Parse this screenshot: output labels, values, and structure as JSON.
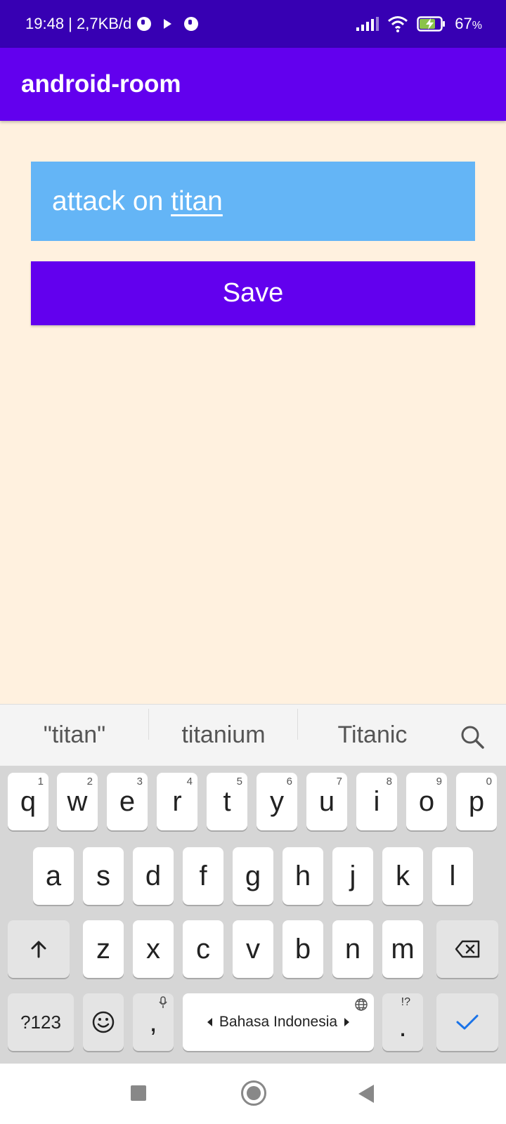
{
  "status_bar": {
    "time_info": "19:48 | 2,7KB/d",
    "battery": "67",
    "battery_unit": "%"
  },
  "app_bar": {
    "title": "android-room"
  },
  "input": {
    "value_prefix": "attack on ",
    "value_composing": "titan"
  },
  "save_button": {
    "label": "Save"
  },
  "suggestions": [
    "\"titan\"",
    "titanium",
    "Titanic"
  ],
  "keyboard": {
    "row1": [
      {
        "key": "q",
        "hint": "1"
      },
      {
        "key": "w",
        "hint": "2"
      },
      {
        "key": "e",
        "hint": "3"
      },
      {
        "key": "r",
        "hint": "4"
      },
      {
        "key": "t",
        "hint": "5"
      },
      {
        "key": "y",
        "hint": "6"
      },
      {
        "key": "u",
        "hint": "7"
      },
      {
        "key": "i",
        "hint": "8"
      },
      {
        "key": "o",
        "hint": "9"
      },
      {
        "key": "p",
        "hint": "0"
      }
    ],
    "row2": [
      "a",
      "s",
      "d",
      "f",
      "g",
      "h",
      "j",
      "k",
      "l"
    ],
    "row3": [
      "z",
      "x",
      "c",
      "v",
      "b",
      "n",
      "m"
    ],
    "symbols_label": "?123",
    "comma": ",",
    "space_label": "Bahasa Indonesia",
    "period": ".",
    "period_hint": "!?",
    "accent_color": "#1a73e8"
  },
  "colors": {
    "status_bar": "#3700b3",
    "app_bar": "#6200ee",
    "background": "#fff1df",
    "input_bg": "#64b5f6",
    "button_bg": "#6200ee"
  }
}
